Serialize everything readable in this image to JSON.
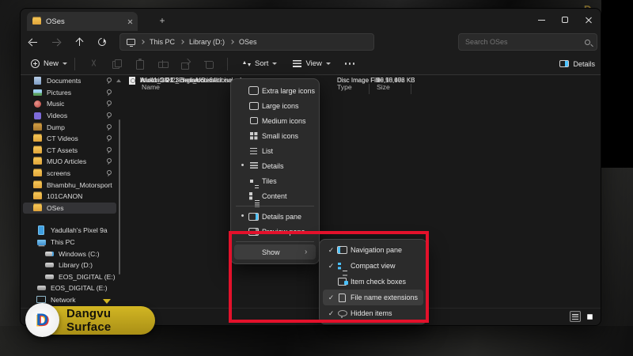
{
  "window": {
    "tab_title": "OSes"
  },
  "breadcrumb": {
    "items": [
      "This PC",
      "Library (D:)",
      "OSes"
    ]
  },
  "search": {
    "placeholder": "Search OSes"
  },
  "toolbar": {
    "new_label": "New",
    "sort_label": "Sort",
    "view_label": "View",
    "details_label": "Details"
  },
  "sidebar": {
    "items": [
      {
        "label": "Documents",
        "icon": "documents-icon",
        "pinned": true
      },
      {
        "label": "Pictures",
        "icon": "pictures-icon",
        "pinned": true
      },
      {
        "label": "Music",
        "icon": "music-icon",
        "pinned": true
      },
      {
        "label": "Videos",
        "icon": "videos-icon",
        "pinned": true
      },
      {
        "label": "Dump",
        "icon": "dump-icon",
        "pinned": true
      },
      {
        "label": "CT Videos",
        "icon": "folder-icon",
        "pinned": true
      },
      {
        "label": "CT Assets",
        "icon": "folder-icon",
        "pinned": true
      },
      {
        "label": "MUO Articles",
        "icon": "folder-icon",
        "pinned": true
      },
      {
        "label": "screens",
        "icon": "folder-icon",
        "pinned": true
      },
      {
        "label": "Bhambhu_Motorsport",
        "icon": "folder-icon"
      },
      {
        "label": "101CANON",
        "icon": "folder-icon"
      },
      {
        "label": "OSes",
        "icon": "folder-icon",
        "selected": true
      },
      {
        "label": "Yadullah's Pixel 9a",
        "icon": "phone-icon",
        "group": true,
        "root": true
      },
      {
        "label": "This PC",
        "icon": "pc-icon",
        "root": true
      },
      {
        "label": "Windows (C:)",
        "icon": "windows-drive-icon",
        "indent": true
      },
      {
        "label": "Library (D:)",
        "icon": "drive-icon",
        "indent": true
      },
      {
        "label": "EOS_DIGITAL (E:)",
        "icon": "drive-icon",
        "indent": true
      },
      {
        "label": "EOS_DIGITAL (E:)",
        "icon": "usb-drive-icon",
        "root": true
      },
      {
        "label": "Network",
        "icon": "network-icon",
        "root": true
      }
    ]
  },
  "files": {
    "columns": {
      "name": "Name",
      "type": "Type",
      "size": "Size"
    },
    "rows": [
      {
        "name": "AnduinOS-1.3.3-en_US.iso",
        "icon": "disc-file-icon",
        "type": "Disc Image File",
        "size": "19,58,976 KB"
      },
      {
        "name": "linuxmint-22.1-cinnamon-64bit.iso",
        "icon": "disc-file-icon",
        "type": "Disc Image File",
        "size": "29,10,656 KB"
      },
      {
        "name": "Win11_24H2_EnglishInternational_x64.iso",
        "icon": "disc-file-icon",
        "type": "Disc Image File",
        "size": "56,95,402 KB"
      }
    ]
  },
  "view_menu": {
    "items": [
      {
        "label": "Extra large icons",
        "icon": "extra-large-icons-icon"
      },
      {
        "label": "Large icons",
        "icon": "large-icons-icon"
      },
      {
        "label": "Medium icons",
        "icon": "medium-icons-icon"
      },
      {
        "label": "Small icons",
        "icon": "small-icons-icon"
      },
      {
        "label": "List",
        "icon": "list-icon"
      },
      {
        "label": "Details",
        "icon": "details-icon",
        "selected": true
      },
      {
        "label": "Tiles",
        "icon": "tiles-icon"
      },
      {
        "label": "Content",
        "icon": "content-icon"
      },
      {
        "label": "Details pane",
        "icon": "details-pane-icon",
        "selected": true,
        "sep_before": true
      },
      {
        "label": "Preview pane",
        "icon": "preview-pane-icon"
      },
      {
        "label": "Show",
        "icon": "",
        "submenu": true,
        "hover": true,
        "sep_before": true
      }
    ]
  },
  "show_submenu": {
    "items": [
      {
        "label": "Navigation pane",
        "icon": "navigation-pane-icon",
        "checked": true
      },
      {
        "label": "Compact view",
        "icon": "compact-view-icon",
        "checked": true
      },
      {
        "label": "Item check boxes",
        "icon": "item-check-boxes-icon"
      },
      {
        "label": "File name extensions",
        "icon": "file-name-extensions-icon",
        "checked": true,
        "hover": true
      },
      {
        "label": "Hidden items",
        "icon": "hidden-items-icon",
        "checked": true
      }
    ]
  },
  "watermark": {
    "label": "Dangvu Surface",
    "glyph": "D"
  },
  "colors": {
    "accent_blue": "#4cc2ff",
    "annotation_red": "#e3112b",
    "pill_yellow": "#c7ac1e",
    "folder_yellow": "#f2c14e"
  }
}
